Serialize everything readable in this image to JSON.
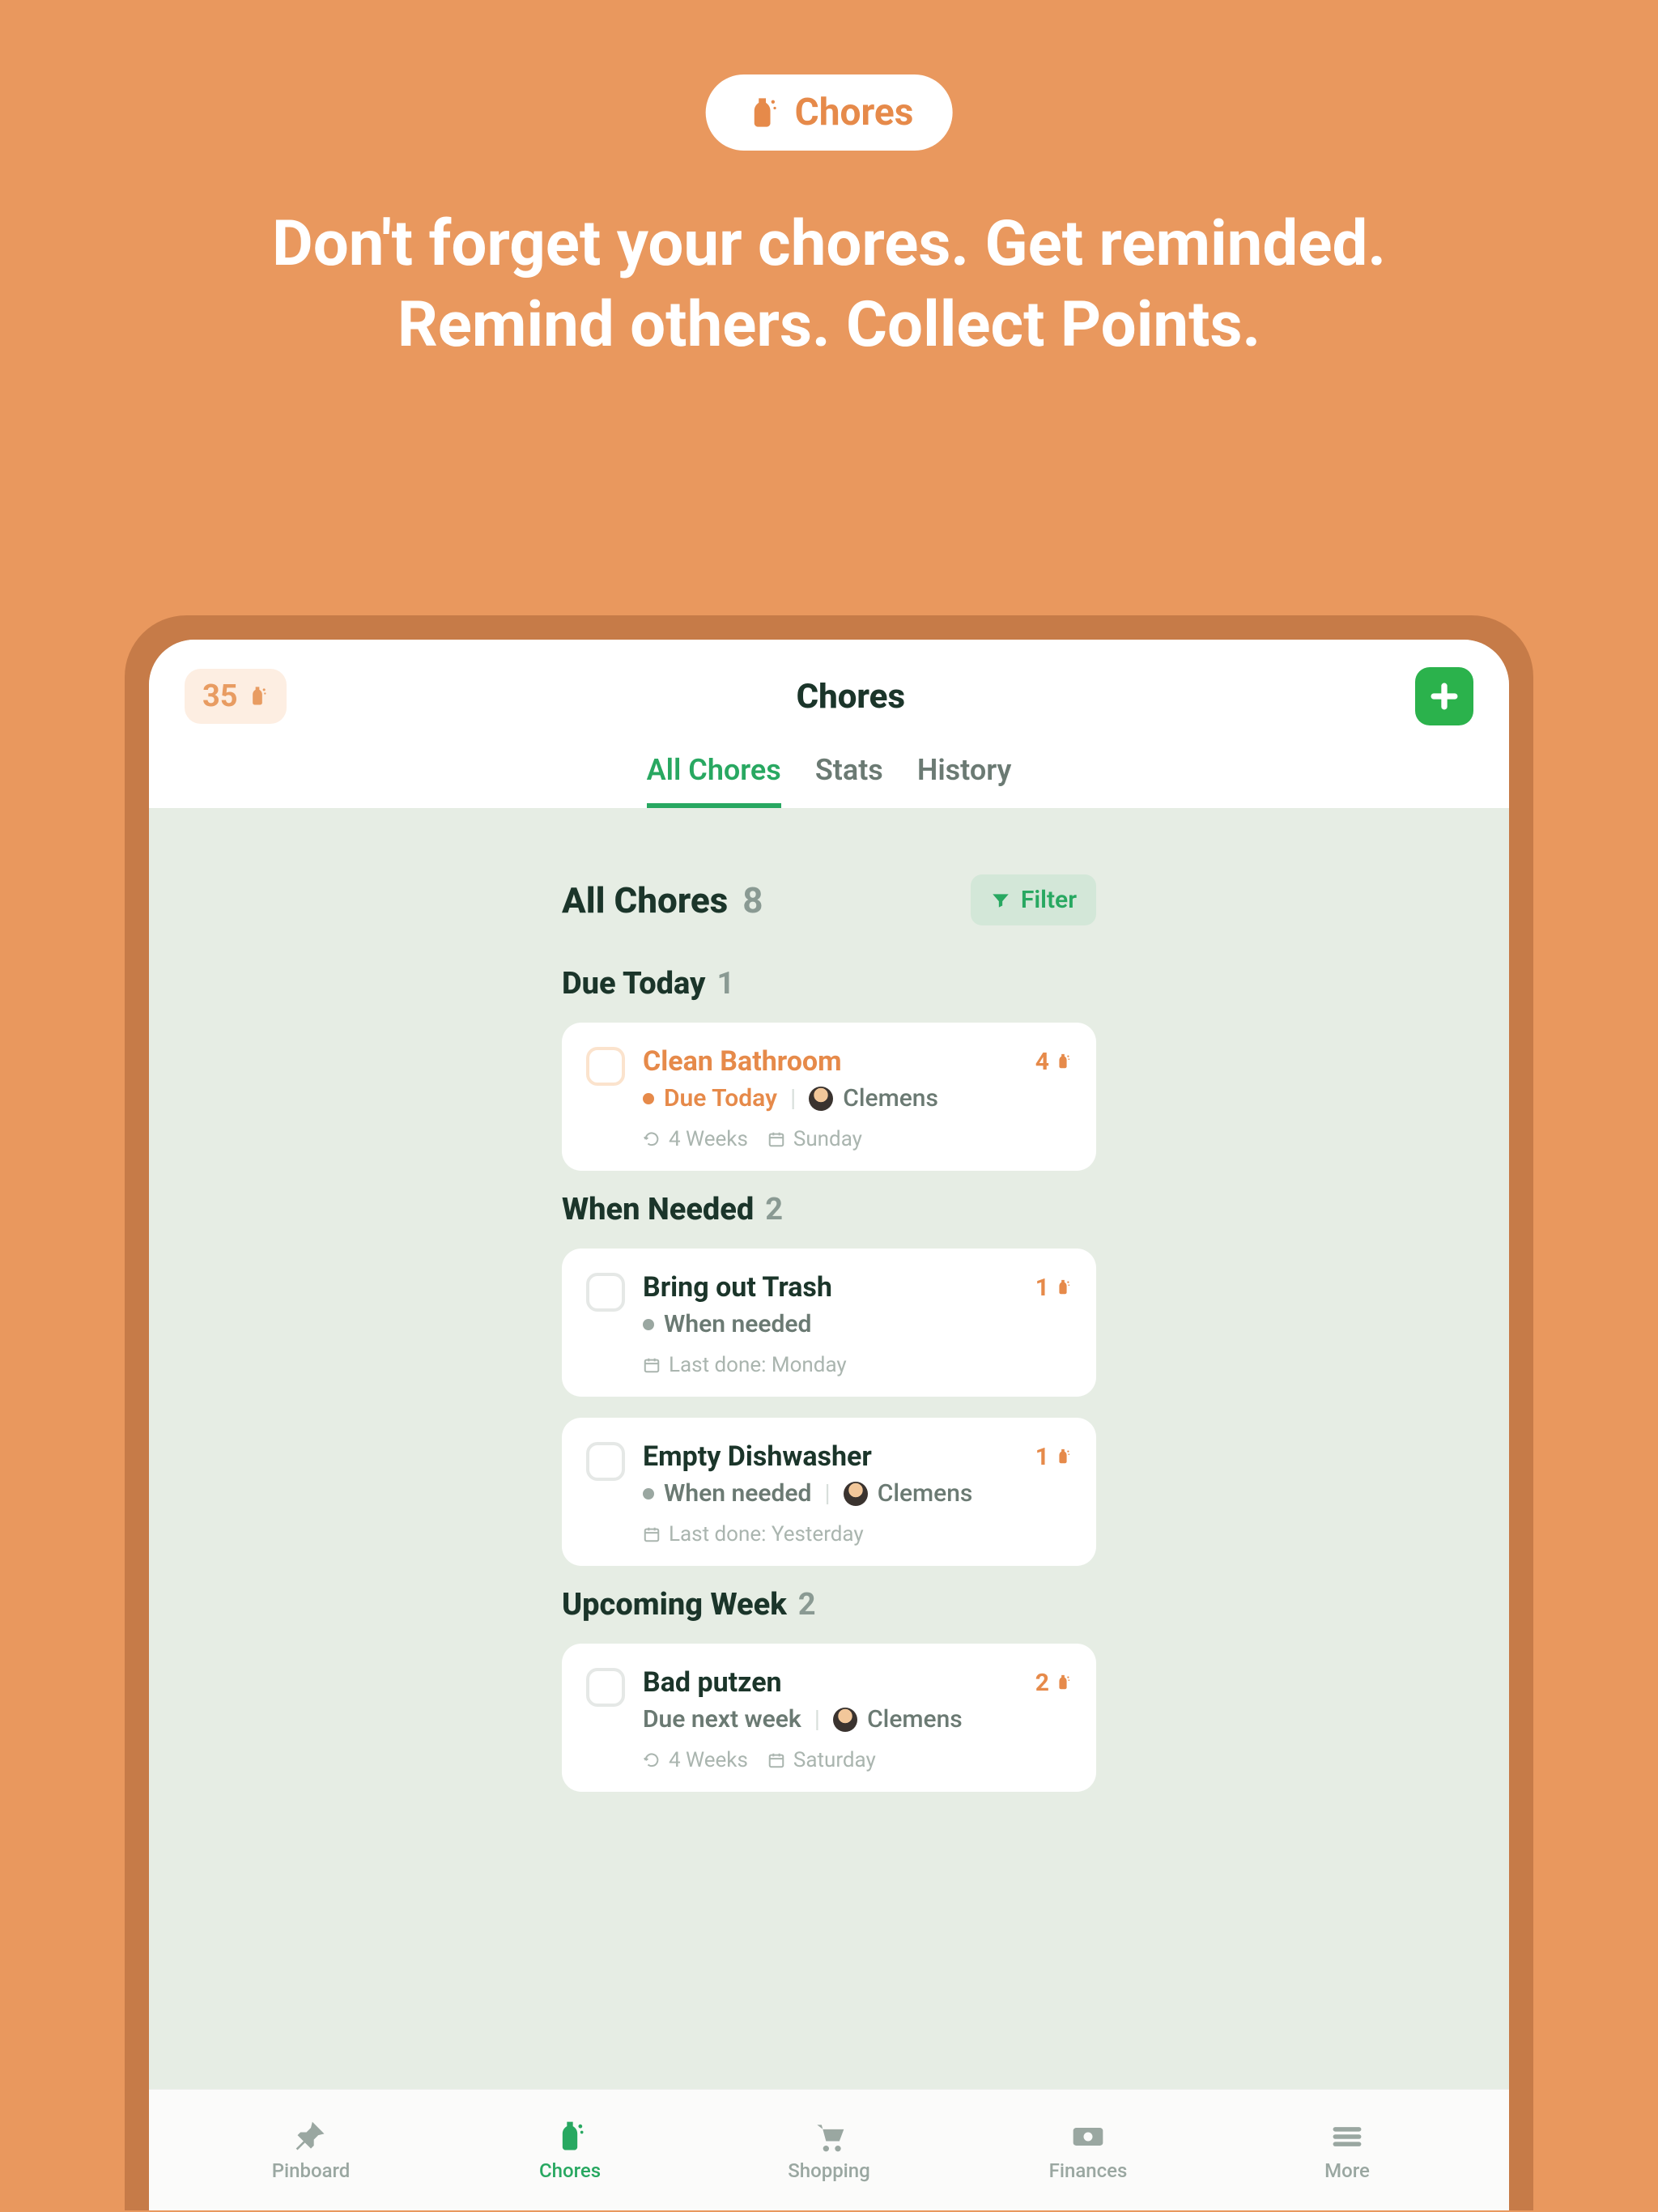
{
  "hero": {
    "badge_label": "Chores",
    "headline": "Don't forget your chores. Get reminded. Remind others. Collect Points."
  },
  "topbar": {
    "points": "35",
    "title": "Chores"
  },
  "tabs": [
    {
      "label": "All Chores",
      "active": true
    },
    {
      "label": "Stats",
      "active": false
    },
    {
      "label": "History",
      "active": false
    }
  ],
  "filter_label": "Filter",
  "all_chores": {
    "title": "All Chores",
    "count": "8"
  },
  "groups": [
    {
      "title": "Due Today",
      "count": "1",
      "items": [
        {
          "title": "Clean Bathroom",
          "title_color": "orange",
          "points": "4",
          "status_dot": "orange",
          "status_text": "Due Today",
          "status_color": "orange",
          "assignee": "Clemens",
          "has_assignee": true,
          "meta": [
            {
              "icon": "repeat",
              "text": "4 Weeks"
            },
            {
              "icon": "calendar",
              "text": "Sunday"
            }
          ],
          "checkbox_style": "orange"
        }
      ]
    },
    {
      "title": "When Needed",
      "count": "2",
      "items": [
        {
          "title": "Bring out Trash",
          "title_color": "dark",
          "points": "1",
          "status_dot": "gray",
          "status_text": "When needed",
          "status_color": "gray",
          "has_assignee": false,
          "meta": [
            {
              "icon": "calendar",
              "text": "Last done: Monday"
            }
          ],
          "checkbox_style": "gray"
        },
        {
          "title": "Empty Dishwasher",
          "title_color": "dark",
          "points": "1",
          "status_dot": "gray",
          "status_text": "When needed",
          "status_color": "gray",
          "assignee": "Clemens",
          "has_assignee": true,
          "meta": [
            {
              "icon": "calendar",
              "text": "Last done: Yesterday"
            }
          ],
          "checkbox_style": "gray"
        }
      ]
    },
    {
      "title": "Upcoming Week",
      "count": "2",
      "items": [
        {
          "title": "Bad putzen",
          "title_color": "dark",
          "points": "2",
          "status_dot": "none",
          "status_text": "Due next week",
          "status_color": "gray",
          "assignee": "Clemens",
          "has_assignee": true,
          "meta": [
            {
              "icon": "repeat",
              "text": "4 Weeks"
            },
            {
              "icon": "calendar",
              "text": "Saturday"
            }
          ],
          "checkbox_style": "gray"
        }
      ]
    }
  ],
  "bottom_nav": [
    {
      "label": "Pinboard",
      "icon": "pin",
      "active": false
    },
    {
      "label": "Chores",
      "icon": "bottle",
      "active": true
    },
    {
      "label": "Shopping",
      "icon": "cart",
      "active": false
    },
    {
      "label": "Finances",
      "icon": "money",
      "active": false
    },
    {
      "label": "More",
      "icon": "menu",
      "active": false
    }
  ],
  "colors": {
    "accent_orange": "#e68a4a",
    "accent_green": "#28a861",
    "bg_orange": "#e9985e"
  }
}
